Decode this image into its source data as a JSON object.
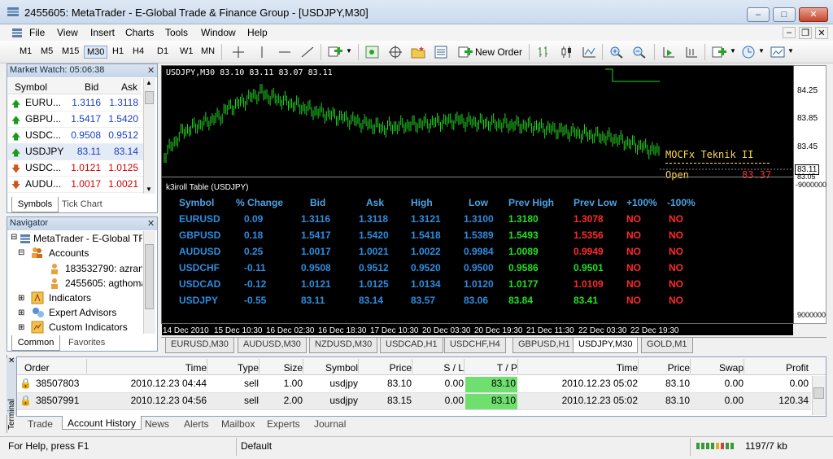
{
  "window": {
    "title": "2455605: MetaTrader - E-Global Trade & Finance Group - [USDJPY,M30]",
    "min": "–",
    "max": "□",
    "close": "✕",
    "doc_min": "–",
    "doc_restore": "❐",
    "doc_close": "✕"
  },
  "menu": [
    "File",
    "View",
    "Insert",
    "Charts",
    "Tools",
    "Window",
    "Help"
  ],
  "toolbar": {
    "timeframes": [
      "M1",
      "M5",
      "M15",
      "M30",
      "H1",
      "H4",
      "D1",
      "W1",
      "MN"
    ],
    "new_order": "New Order"
  },
  "market_watch": {
    "title": "Market Watch: 05:06:38",
    "columns": [
      "Symbol",
      "Bid",
      "Ask"
    ],
    "rows": [
      {
        "symbol": "EURU...",
        "bid": "1.3116",
        "ask": "1.3118",
        "dir": "up"
      },
      {
        "symbol": "GBPU...",
        "bid": "1.5417",
        "ask": "1.5420",
        "dir": "up"
      },
      {
        "symbol": "USDC...",
        "bid": "0.9508",
        "ask": "0.9512",
        "dir": "up"
      },
      {
        "symbol": "USDJPY",
        "bid": "83.11",
        "ask": "83.14",
        "dir": "up"
      },
      {
        "symbol": "USDC...",
        "bid": "1.0121",
        "ask": "1.0125",
        "dir": "down"
      },
      {
        "symbol": "AUDU...",
        "bid": "1.0017",
        "ask": "1.0021",
        "dir": "down"
      }
    ],
    "tabs": [
      "Symbols",
      "Tick Chart"
    ]
  },
  "navigator": {
    "title": "Navigator",
    "items": [
      "MetaTrader - E-Global TF",
      "Accounts",
      "183532790: azran a",
      "2455605: agthoma",
      "Indicators",
      "Expert Advisors",
      "Custom Indicators"
    ],
    "tabs": [
      "Common",
      "Favorites"
    ]
  },
  "chart": {
    "header": "USDJPY,M30  83.10 83.11 83.07 83.11",
    "price_labels": [
      "84.25",
      "83.85",
      "83.45",
      "83.11",
      "83.05"
    ],
    "indicator_label": "MOCFx Teknik II",
    "open_label": "Open",
    "open_value": "83.37",
    "sub_title": "k3iroll Table (USDJPY)",
    "sub_scale_top": "-9000000",
    "sub_scale_bottom": "9000000",
    "time_labels": [
      "14 Dec 2010",
      "15 Dec 10:30",
      "16 Dec 02:30",
      "16 Dec 18:30",
      "17 Dec 10:30",
      "20 Dec 03:30",
      "20 Dec 19:30",
      "21 Dec 11:30",
      "22 Dec 03:30",
      "22 Dec 19:30"
    ]
  },
  "k3table": {
    "columns": [
      "Symbol",
      "% Change",
      "Bid",
      "Ask",
      "High",
      "Low",
      "Prev High",
      "Prev Low",
      "+100%",
      "-100%"
    ],
    "rows": [
      {
        "symbol": "EURUSD",
        "change": "0.09",
        "bid": "1.3116",
        "ask": "1.3118",
        "high": "1.3121",
        "low": "1.3100",
        "prevhigh": "1.3180",
        "prevlow": "1.3078",
        "p100": "NO",
        "m100": "NO",
        "plc": "r"
      },
      {
        "symbol": "GBPUSD",
        "change": "0.18",
        "bid": "1.5417",
        "ask": "1.5420",
        "high": "1.5418",
        "low": "1.5389",
        "prevhigh": "1.5493",
        "prevlow": "1.5356",
        "p100": "NO",
        "m100": "NO",
        "plc": "r"
      },
      {
        "symbol": "AUDUSD",
        "change": "0.25",
        "bid": "1.0017",
        "ask": "1.0021",
        "high": "1.0022",
        "low": "0.9984",
        "prevhigh": "1.0089",
        "prevlow": "0.9949",
        "p100": "NO",
        "m100": "NO",
        "plc": "r"
      },
      {
        "symbol": "USDCHF",
        "change": "-0.11",
        "bid": "0.9508",
        "ask": "0.9512",
        "high": "0.9520",
        "low": "0.9500",
        "prevhigh": "0.9586",
        "prevlow": "0.9501",
        "p100": "NO",
        "m100": "NO",
        "plc": "g"
      },
      {
        "symbol": "USDCAD",
        "change": "-0.12",
        "bid": "1.0121",
        "ask": "1.0125",
        "high": "1.0134",
        "low": "1.0120",
        "prevhigh": "1.0177",
        "prevlow": "1.0109",
        "p100": "NO",
        "m100": "NO",
        "plc": "r"
      },
      {
        "symbol": "USDJPY",
        "change": "-0.55",
        "bid": "83.11",
        "ask": "83.14",
        "high": "83.57",
        "low": "83.06",
        "prevhigh": "83.84",
        "prevlow": "83.41",
        "p100": "NO",
        "m100": "NO",
        "plc": "g"
      }
    ]
  },
  "chart_tabs": [
    "EURUSD,M30",
    "AUDUSD,M30",
    "NZDUSD,M30",
    "USDCAD,H1",
    "USDCHF,H4",
    "GBPUSD,H1",
    "USDJPY,M30",
    "GOLD,M1"
  ],
  "terminal": {
    "side_label": "Terminal",
    "columns": [
      "Order",
      "Time",
      "Type",
      "Size",
      "Symbol",
      "Price",
      "S / L",
      "T / P",
      "Time",
      "Price",
      "Swap",
      "Profit"
    ],
    "rows": [
      [
        "38507803",
        "2010.12.23 04:44",
        "sell",
        "1.00",
        "usdjpy",
        "83.10",
        "0.00",
        "83.10",
        "2010.12.23 05:02",
        "83.10",
        "0.00",
        "0.00"
      ],
      [
        "38507991",
        "2010.12.23 04:56",
        "sell",
        "2.00",
        "usdjpy",
        "83.15",
        "0.00",
        "83.10",
        "2010.12.23 05:02",
        "83.10",
        "0.00",
        "120.34"
      ]
    ],
    "tabs": [
      "Trade",
      "Account History",
      "News",
      "Alerts",
      "Mailbox",
      "Experts",
      "Journal"
    ]
  },
  "status": {
    "help": "For Help, press F1",
    "profile": "Default",
    "traffic": "1197/7 kb"
  }
}
